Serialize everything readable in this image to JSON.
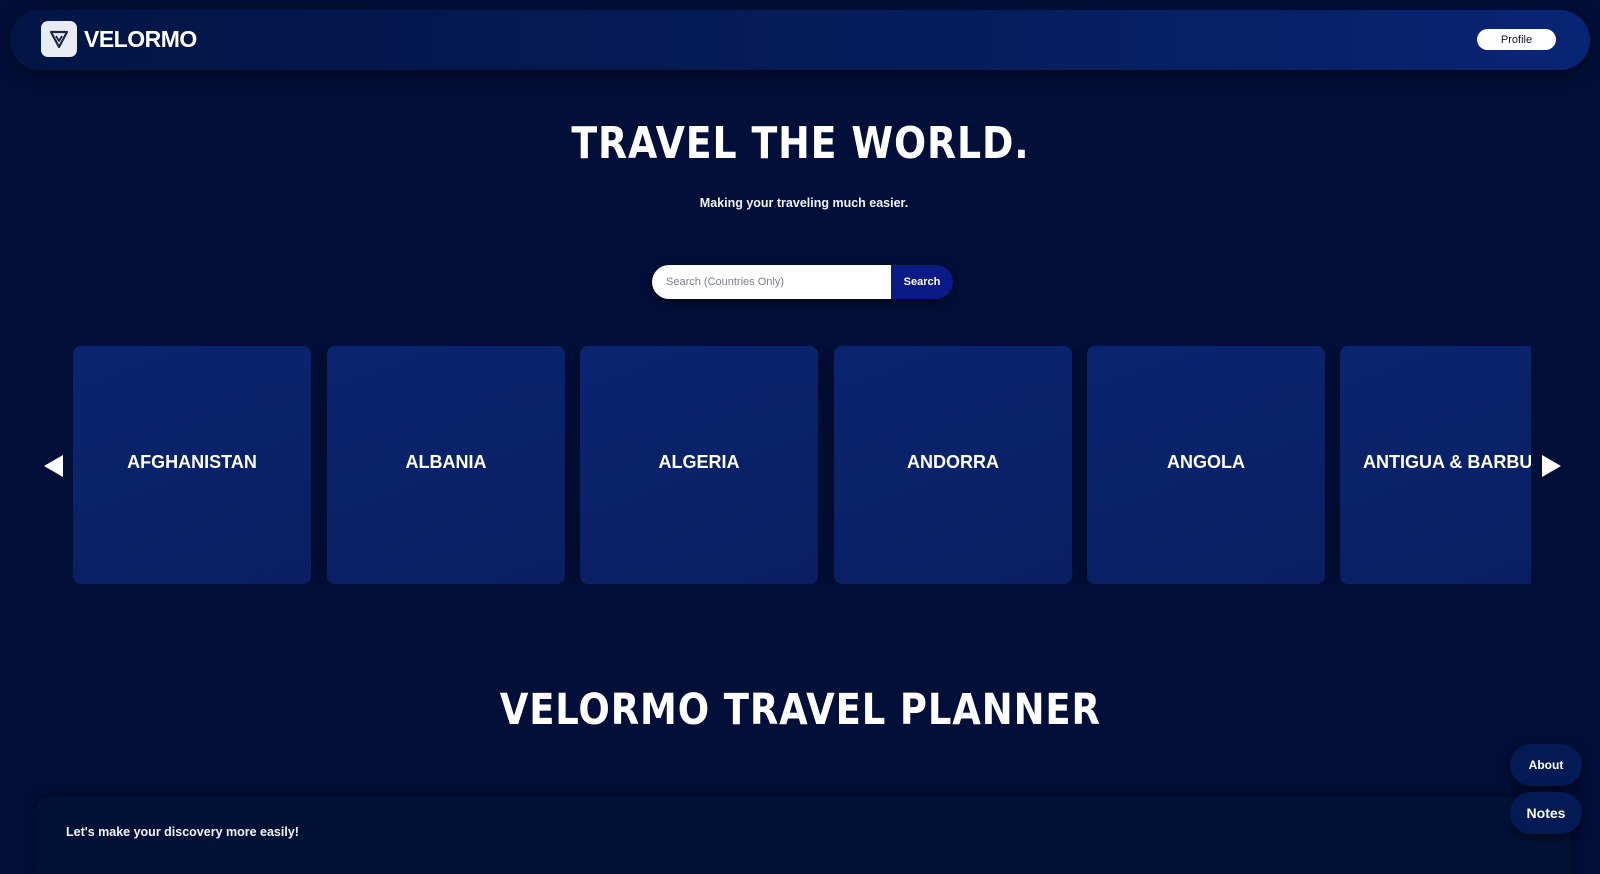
{
  "header": {
    "brand": "VELORMO",
    "profile_label": "Profile"
  },
  "hero": {
    "title": "TRAVEL THE WORLD.",
    "subtitle": "Making your traveling much easier."
  },
  "search": {
    "placeholder": "Search (Countries Only)",
    "value": "",
    "button_label": "Search"
  },
  "carousel": {
    "cards": [
      {
        "name": "AFGHANISTAN"
      },
      {
        "name": "ALBANIA"
      },
      {
        "name": "ALGERIA"
      },
      {
        "name": "ANDORRA"
      },
      {
        "name": "ANGOLA"
      },
      {
        "name": "ANTIGUA & BARBU"
      }
    ],
    "prev_icon": "triangle-left-icon",
    "next_icon": "triangle-right-icon"
  },
  "planner": {
    "title": "VELORMO TRAVEL PLANNER",
    "intro": "Let's make your discovery more easily!"
  },
  "floating": {
    "about_label": "About",
    "notes_label": "Notes"
  },
  "colors": {
    "background": "#020f38",
    "card": "#0b2470",
    "search_button": "#0b1a86",
    "header": "#061d5c"
  }
}
